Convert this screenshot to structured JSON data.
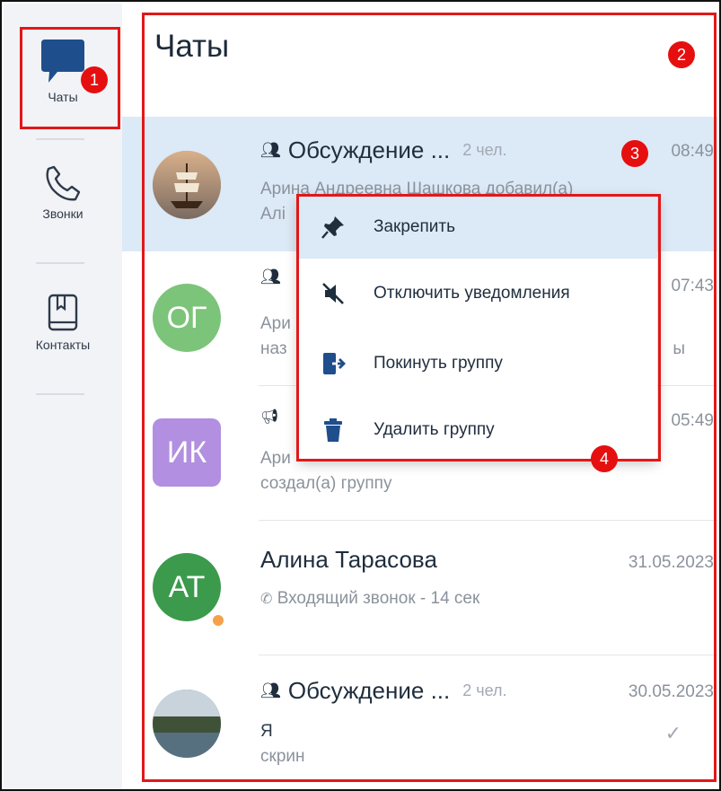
{
  "sidebar": {
    "items": [
      {
        "label": "Чаты",
        "icon": "chat-bubble-icon"
      },
      {
        "label": "Звонки",
        "icon": "phone-icon"
      },
      {
        "label": "Контакты",
        "icon": "address-book-icon"
      }
    ]
  },
  "main": {
    "title": "Чаты"
  },
  "chats": [
    {
      "title": "Обсуждение ...",
      "members": "2 чел.",
      "time": "08:49",
      "line1": "Арина Андреевна Шашкова добавил(а)",
      "line2": "Алі",
      "avatar": "ship-photo"
    },
    {
      "title": "",
      "members": "",
      "time": "07:43",
      "line1": "Ари",
      "line2": "наз",
      "line2_tail": "ы",
      "avatar_initials": "ОГ",
      "avatar_color": "#7cc47a"
    },
    {
      "title": "",
      "members": "",
      "time": "05:49",
      "line1": "Ари",
      "line2": "создал(а) группу",
      "avatar_initials": "ИК",
      "avatar_color": "#b28fe0"
    },
    {
      "title": "Алина Тарасова",
      "time": "31.05.2023",
      "line1": "Входящий звонок - 14 сек",
      "avatar_initials": "АТ",
      "avatar_color": "#3b9a4c"
    },
    {
      "title": "Обсуждение ...",
      "members": "2 чел.",
      "time": "30.05.2023",
      "line1": "Я",
      "line2": "скрин",
      "avatar": "lake-photo"
    }
  ],
  "context_menu": {
    "items": [
      {
        "label": "Закрепить",
        "icon": "pin-icon"
      },
      {
        "label": "Отключить уведомления",
        "icon": "mute-icon"
      },
      {
        "label": "Покинуть группу",
        "icon": "leave-icon"
      },
      {
        "label": "Удалить группу",
        "icon": "trash-icon"
      }
    ]
  },
  "annotations": {
    "b1": "1",
    "b2": "2",
    "b3": "3",
    "b4": "4"
  },
  "colors": {
    "accent": "#1f4e8c",
    "highlight": "#e11818",
    "active_row": "#dce9f6"
  }
}
